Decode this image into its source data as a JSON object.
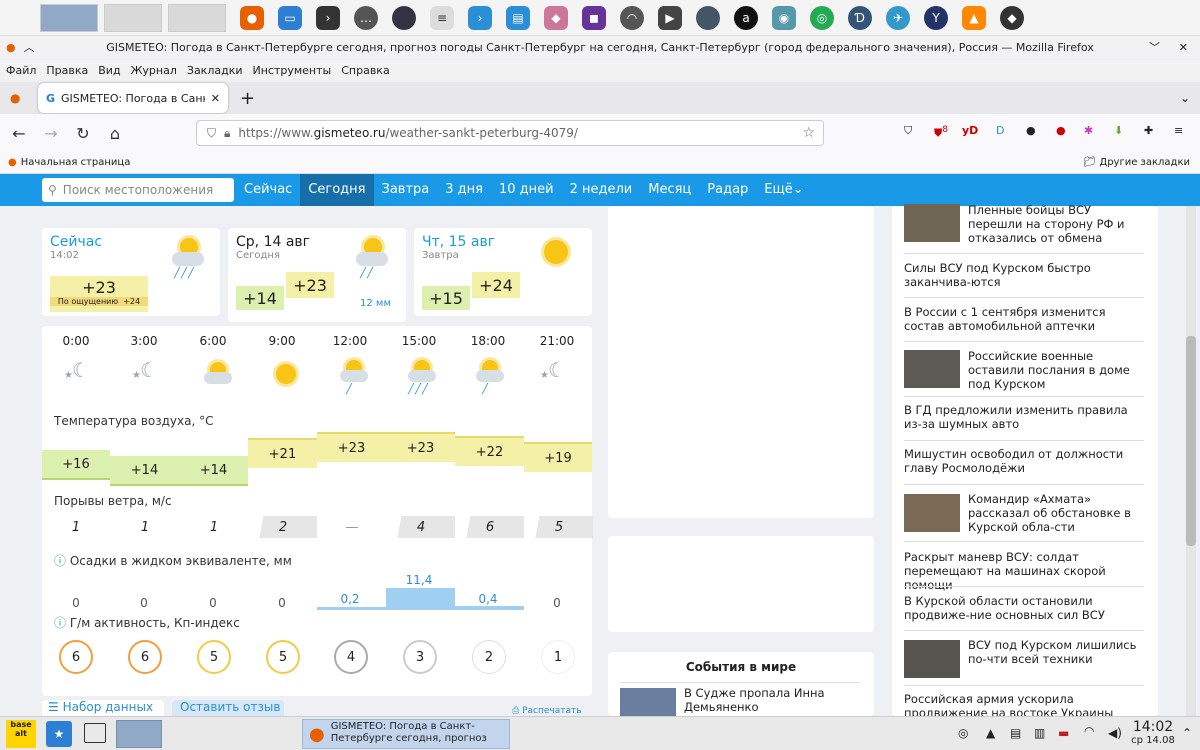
{
  "window": {
    "title": "GISMETEO: Погода в Санкт-Петербурге сегодня, прогноз погоды Санкт-Петербург на сегодня, Санкт-Петербург (город федерального значения), Россия — Mozilla Firefox"
  },
  "menu": [
    "Файл",
    "Правка",
    "Вид",
    "Журнал",
    "Закладки",
    "Инструменты",
    "Справка"
  ],
  "tab": {
    "favicon": "G",
    "label": "GISMETEO: Погода в Санкт-Пет"
  },
  "url": {
    "prefix": "https://www.",
    "host": "gismeteo.ru",
    "path": "/weather-sankt-peterburg-4079/"
  },
  "bookmarks": {
    "home": "Начальная страница",
    "other": "Другие закладки"
  },
  "ext": {
    "yd": "yD",
    "badge": "8"
  },
  "sitenav": {
    "search_placeholder": "Поиск местоположения",
    "links": [
      "Сейчас",
      "Сегодня",
      "Завтра",
      "3 дня",
      "10 дней",
      "2 недели",
      "Месяц",
      "Радар",
      "Ещё"
    ]
  },
  "now": {
    "title": "Сейчас",
    "time": "14:02",
    "temp": "+23",
    "feels_label": "По ощущению",
    "feels_value": "+24"
  },
  "today": {
    "title": "Ср, 14 авг",
    "sub": "Сегодня",
    "tmin": "+14",
    "tmax": "+23",
    "precip": "12 мм"
  },
  "tomorrow": {
    "title": "Чт, 15 авг",
    "sub": "Завтра",
    "tmin": "+15",
    "tmax": "+24"
  },
  "hours": [
    "0:00",
    "3:00",
    "6:00",
    "9:00",
    "12:00",
    "15:00",
    "18:00",
    "21:00"
  ],
  "temp_label": "Температура воздуха, °C",
  "temps": [
    "+16",
    "+14",
    "+14",
    "+21",
    "+23",
    "+23",
    "+22",
    "+19"
  ],
  "wind_label": "Порывы ветра, м/с",
  "wind": [
    "1",
    "1",
    "1",
    "2",
    "—",
    "4",
    "6",
    "5"
  ],
  "precip_label": "Осадки в жидком эквиваленте, мм",
  "precip": [
    "0",
    "0",
    "0",
    "0",
    "0,2",
    "11,4",
    "0,4",
    "0"
  ],
  "kp_label": "Г/м активность, Кп-индекс",
  "kp": [
    "6",
    "6",
    "5",
    "5",
    "4",
    "3",
    "2",
    "1"
  ],
  "bottom_buttons": {
    "data": "Набор данных",
    "review": "Оставить отзыв",
    "print": "Распечатать"
  },
  "world": {
    "title": "События в мире",
    "item": "В Судже пропала Инна Демьяненко"
  },
  "news": [
    "Пленные бойцы ВСУ перешли на сторону РФ и отказались от обмена",
    "Силы ВСУ под Курском быстро заканчива-ются",
    "В России с 1 сентября изменится состав автомобильной аптечки",
    "Российские военные оставили послания в доме под Курском",
    "В ГД предложили изменить правила из-за шумных авто",
    "Мишустин освободил от должности главу Росмолодёжи",
    "Командир «Ахмата» рассказал об обстановке в Курской обла-сти",
    "Раскрыт маневр ВСУ: солдат перемещают на машинах скорой помощи",
    "В Курской области остановили продвиже-ние основных сил ВСУ",
    "ВСУ под Курском лишились по-чти всей техники",
    "Российская армия ускорила продвижение на востоке Украины"
  ],
  "taskbar": {
    "start": "base alt",
    "task": "GISMETEO: Погода в Санкт-Петербурге сегодня, прогноз пого...",
    "time": "14:02",
    "date": "ср 14.08"
  }
}
